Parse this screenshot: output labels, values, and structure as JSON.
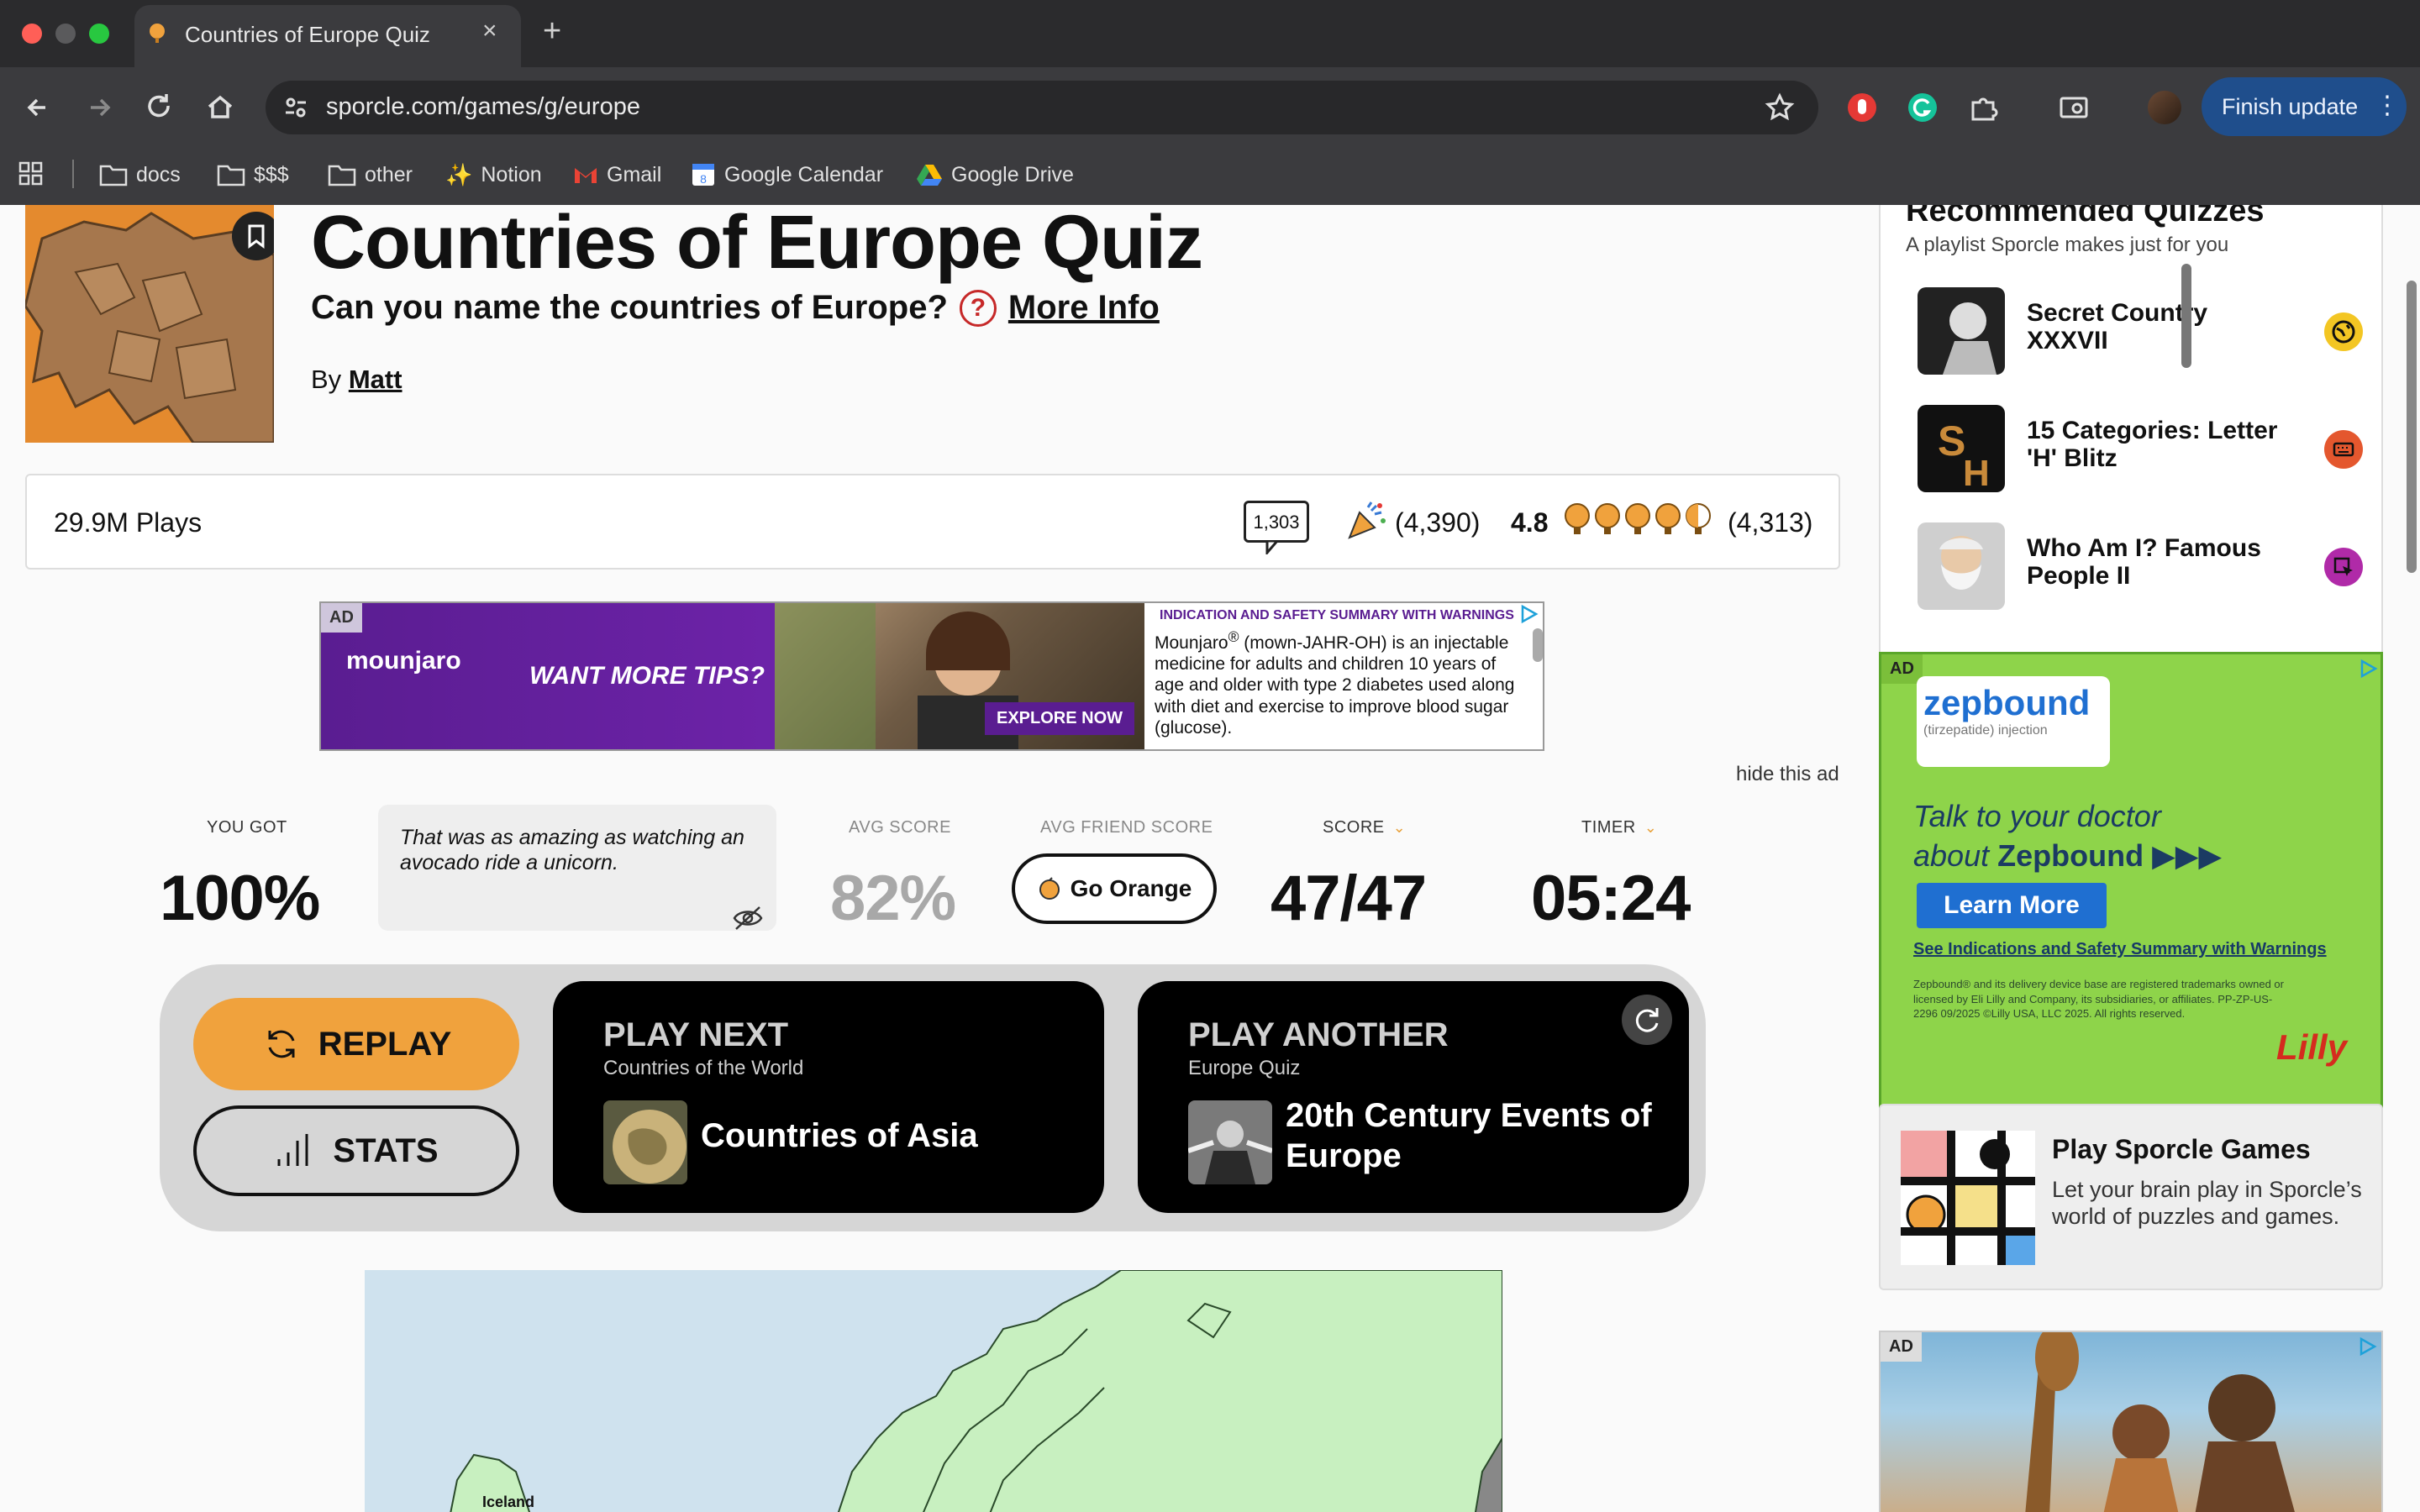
{
  "browser": {
    "tab_title": "Countries of Europe Quiz",
    "url": "sporcle.com/games/g/europe",
    "finish_update_label": "Finish update",
    "bookmarks": [
      "docs",
      "$$$",
      "other",
      "Notion",
      "Gmail",
      "Google Calendar",
      "Google Drive"
    ]
  },
  "quiz": {
    "title": "Countries of Europe Quiz",
    "subtitle": "Can you name the countries of Europe?",
    "more_info": "More Info",
    "by_label": "By",
    "author": "Matt",
    "plays": "29.9M Plays",
    "comments": "1,303",
    "favorites": "(4,390)",
    "rating": "4.8",
    "rating_count": "(4,313)",
    "rating_stars": 4.8
  },
  "ad_banner": {
    "tag": "AD",
    "brand": "mounjaro",
    "tips": "WANT MORE TIPS?",
    "cta": "EXPLORE NOW",
    "safety_title": "INDICATION AND SAFETY SUMMARY WITH WARNINGS",
    "safety_text_1": "Mounjaro",
    "safety_text_2": " (mown-JAHR-OH) is an injectable medicine for adults and children 10 years of age and older with type 2 diabetes used along with diet and exercise to improve blood sugar (glucose).",
    "hide_label": "hide this ad"
  },
  "result": {
    "you_got_label": "YOU GOT",
    "you_got": "100%",
    "quote": "That was as amazing as watching an avocado ride a unicorn.",
    "avg_score_label": "AVG SCORE",
    "avg_score": "82%",
    "avg_friend_label": "AVG FRIEND SCORE",
    "go_orange": "Go Orange",
    "score_label": "SCORE",
    "score": "47/47",
    "timer_label": "TIMER",
    "timer": "05:24"
  },
  "actions": {
    "replay": "REPLAY",
    "stats": "STATS",
    "play_next": {
      "head": "PLAY NEXT",
      "sub": "Countries of the World",
      "title": "Countries of Asia"
    },
    "play_another": {
      "head": "PLAY ANOTHER",
      "sub": "Europe Quiz",
      "title_1": "20th Century Events of",
      "title_2": "Europe"
    }
  },
  "map": {
    "label": "Iceland"
  },
  "sidebar": {
    "rec_title": "Recommended Quizzes",
    "rec_sub": "A playlist Sporcle makes just for you",
    "rec_items": [
      {
        "name": "Secret Country XXXVII",
        "badge_color": "#f3c623"
      },
      {
        "name": "15 Categories: Letter 'H' Blitz",
        "badge_color": "#e4572e"
      },
      {
        "name": "Who Am I? Famous People II",
        "badge_color": "#b02aa8"
      }
    ],
    "ad_tag": "AD",
    "zb_name": "zepbound",
    "zb_tag": "(tirzepatide) injection",
    "zb_talk_1": "Talk to your doctor",
    "zb_talk_2": "about",
    "zb_talk_brand": "Zepbound",
    "zb_learn": "Learn More",
    "zb_safety": "See Indications and Safety Summary with Warnings",
    "zb_fine": "Zepbound® and its delivery device base are registered trademarks owned or licensed by Eli Lilly and Company, its subsidiaries, or affiliates. PP-ZP-US-2296 09/2025 ©Lilly USA, LLC 2025. All rights reserved.",
    "zb_lilly": "Lilly",
    "games_title": "Play Sporcle Games",
    "games_text": "Let your brain play in Sporcle’s world of puzzles and games.",
    "ad2_tag": "AD"
  },
  "colors": {
    "accent_orange": "#f0a23d",
    "ad_purple": "#5a1d91",
    "zepbound_green": "#8ed44a",
    "update_blue": "#1f4e8c"
  }
}
